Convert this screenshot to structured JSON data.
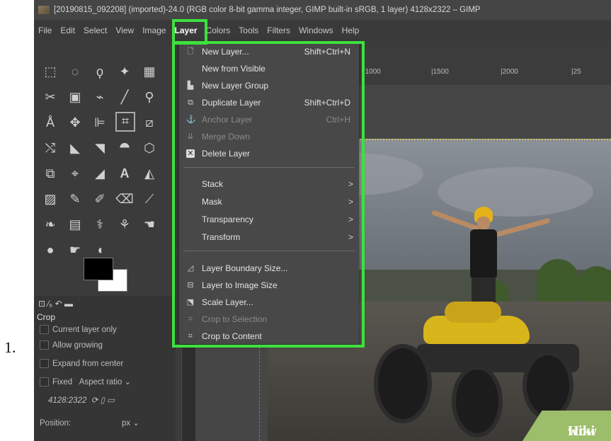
{
  "step_number": "1.",
  "window": {
    "title": "[20190815_092208] (imported)-24.0 (RGB color 8-bit gamma integer, GIMP built-in sRGB, 1 layer) 4128x2322 – GIMP"
  },
  "menubar": {
    "items": [
      "File",
      "Edit",
      "Select",
      "View",
      "Image",
      "Layer",
      "Colors",
      "Tools",
      "Filters",
      "Windows",
      "Help"
    ],
    "active": "Layer"
  },
  "ruler": {
    "ticks": [
      "|1000",
      "|1500",
      "|2000",
      "|25"
    ]
  },
  "layer_menu": {
    "items": [
      {
        "label": "New Layer...",
        "shortcut": "Shift+Ctrl+N",
        "icon": "new-layer-icon",
        "disabled": false
      },
      {
        "label": "New from Visible",
        "shortcut": "",
        "icon": "",
        "disabled": false
      },
      {
        "label": "New Layer Group",
        "shortcut": "",
        "icon": "layer-group-icon",
        "disabled": false
      },
      {
        "label": "Duplicate Layer",
        "shortcut": "Shift+Ctrl+D",
        "icon": "duplicate-icon",
        "disabled": false
      },
      {
        "label": "Anchor Layer",
        "shortcut": "Ctrl+H",
        "icon": "anchor-icon",
        "disabled": true
      },
      {
        "label": "Merge Down",
        "shortcut": "",
        "icon": "merge-down-icon",
        "disabled": true
      },
      {
        "label": "Delete Layer",
        "shortcut": "",
        "icon": "delete-icon",
        "disabled": false
      },
      {
        "label": "Stack",
        "submenu": true
      },
      {
        "label": "Mask",
        "submenu": true
      },
      {
        "label": "Transparency",
        "submenu": true
      },
      {
        "label": "Transform",
        "submenu": true
      },
      {
        "label": "Layer Boundary Size...",
        "icon": "boundary-size-icon",
        "disabled": false
      },
      {
        "label": "Layer to Image Size",
        "icon": "layer-to-image-icon",
        "disabled": false
      },
      {
        "label": "Scale Layer...",
        "icon": "scale-icon",
        "disabled": false
      },
      {
        "label": "Crop to Selection",
        "icon": "crop-icon",
        "disabled": true
      },
      {
        "label": "Crop to Content",
        "icon": "crop-icon",
        "disabled": false
      }
    ]
  },
  "tool_options": {
    "title": "Crop",
    "current_layer_only": "Current layer only",
    "allow_growing": "Allow growing",
    "expand_from_center": "Expand from center",
    "fixed": "Fixed",
    "aspect_ratio": "Aspect ratio",
    "ratio_value": "4128:2322",
    "position_label": "Position:",
    "unit": "px"
  },
  "watermark": {
    "text_a": "wiki",
    "text_b": "How"
  },
  "colors": {
    "highlight": "#3ee03e",
    "menu_bg": "#484848",
    "app_bg": "#3c3c3c"
  }
}
